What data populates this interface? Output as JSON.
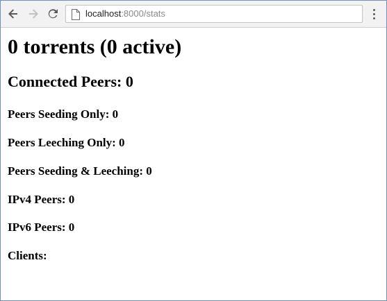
{
  "browser": {
    "url_host": "localhost",
    "url_path": ":8000/stats",
    "icons": [
      "back-arrow-icon",
      "forward-arrow-icon",
      "reload-icon",
      "page-icon",
      "kebab-menu-icon"
    ]
  },
  "page": {
    "title": "0 torrents (0 active)",
    "connected_peers": "Connected Peers: 0",
    "stats": [
      "Peers Seeding Only: 0",
      "Peers Leeching Only: 0",
      "Peers Seeding & Leeching: 0",
      "IPv4 Peers: 0",
      "IPv6 Peers: 0",
      "Clients:"
    ]
  }
}
